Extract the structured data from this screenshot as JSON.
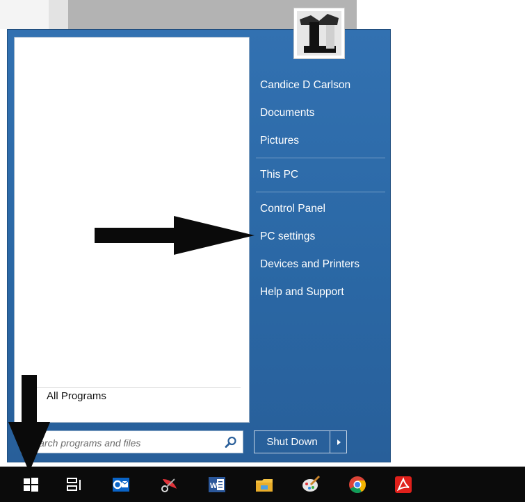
{
  "start_menu": {
    "all_programs_label": "All Programs",
    "search_placeholder": "Search programs and files",
    "search_value": "",
    "user_name": "Candice D Carlson",
    "right_items_group1": [
      "Candice D Carlson",
      "Documents",
      "Pictures"
    ],
    "right_items_group2": [
      "This PC"
    ],
    "right_items_group3": [
      "Control Panel",
      "PC settings",
      "Devices and Printers",
      "Help and Support"
    ],
    "shutdown_label": "Shut Down",
    "accent_color": "#2b6aa8"
  },
  "taskbar": {
    "icons": [
      "windows-start-icon",
      "task-view-icon",
      "outlook-icon",
      "snipping-tool-icon",
      "word-icon",
      "file-explorer-icon",
      "paint-icon",
      "chrome-icon",
      "acrobat-icon"
    ]
  },
  "annotations": {
    "arrows": [
      "arrow-pointing-to-pc-settings",
      "arrow-pointing-to-start-button"
    ]
  }
}
